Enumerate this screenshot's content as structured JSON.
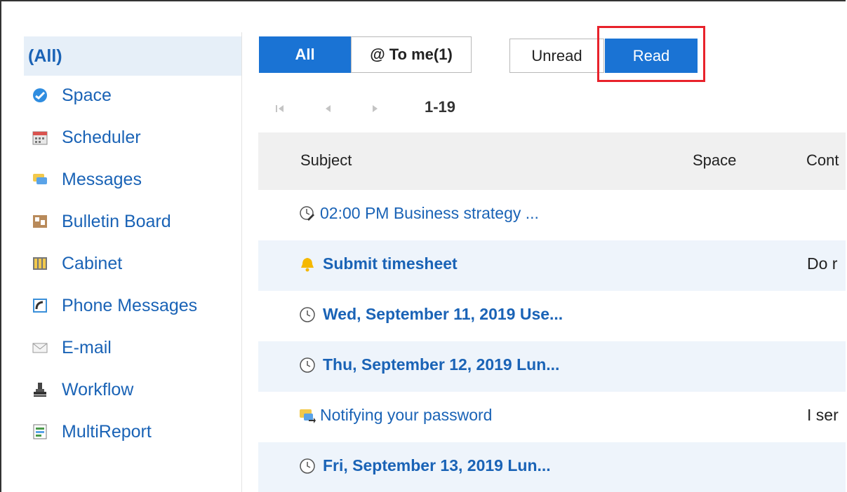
{
  "sidebar": {
    "items": [
      {
        "label": "(All)",
        "icon": "none",
        "selected": true
      },
      {
        "label": "Space",
        "icon": "space-globe-icon"
      },
      {
        "label": "Scheduler",
        "icon": "calendar-icon"
      },
      {
        "label": "Messages",
        "icon": "speech-bubble-icon"
      },
      {
        "label": "Bulletin Board",
        "icon": "bulletin-board-icon"
      },
      {
        "label": "Cabinet",
        "icon": "cabinet-icon"
      },
      {
        "label": "Phone Messages",
        "icon": "phone-icon"
      },
      {
        "label": "E-mail",
        "icon": "envelope-icon"
      },
      {
        "label": "Workflow",
        "icon": "stamp-icon"
      },
      {
        "label": "MultiReport",
        "icon": "report-icon"
      }
    ]
  },
  "tabs": {
    "all": "All",
    "to_me": "@ To me(1)",
    "unread": "Unread",
    "read": "Read"
  },
  "pager": {
    "range": "1-19"
  },
  "table": {
    "headers": {
      "subject": "Subject",
      "space": "Space",
      "content": "Cont"
    },
    "rows": [
      {
        "icon": "clock-edit-icon",
        "subject": "02:00 PM Business strategy ...",
        "content": "",
        "bold": false
      },
      {
        "icon": "bell-icon",
        "subject": "Submit timesheet",
        "content": "Do r",
        "bold": true
      },
      {
        "icon": "clock-icon",
        "subject": "Wed, September 11, 2019 Use...",
        "content": "",
        "bold": true
      },
      {
        "icon": "clock-icon",
        "subject": "Thu, September 12, 2019 Lun...",
        "content": "",
        "bold": true
      },
      {
        "icon": "message-forward-icon",
        "subject": "Notifying your password",
        "content": "I ser",
        "bold": false
      },
      {
        "icon": "clock-icon",
        "subject": "Fri, September 13, 2019 Lun...",
        "content": "",
        "bold": true
      }
    ]
  },
  "colors": {
    "accent": "#1a73d4",
    "link": "#1a63b6",
    "highlight": "#e8222b",
    "row_alt": "#eef4fb",
    "header_bg": "#f0f0f0"
  }
}
